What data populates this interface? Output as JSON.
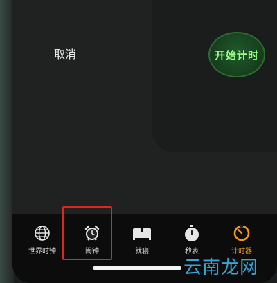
{
  "timer": {
    "cancel_label": "取消",
    "start_label": "开始计时"
  },
  "tabbar": {
    "items": [
      {
        "label": "世界时钟",
        "icon": "globe-icon"
      },
      {
        "label": "闹钟",
        "icon": "alarm-clock-icon"
      },
      {
        "label": "就寝",
        "icon": "bed-icon"
      },
      {
        "label": "秒表",
        "icon": "stopwatch-icon"
      },
      {
        "label": "计时器",
        "icon": "timer-icon"
      }
    ],
    "active_index": 4
  },
  "colors": {
    "accent_active": "#f39a1a",
    "start_text": "#9cff8a",
    "highlight_box": "#e0241f",
    "watermark": "#36a6d6"
  },
  "watermark": {
    "text": "云南龙网"
  }
}
